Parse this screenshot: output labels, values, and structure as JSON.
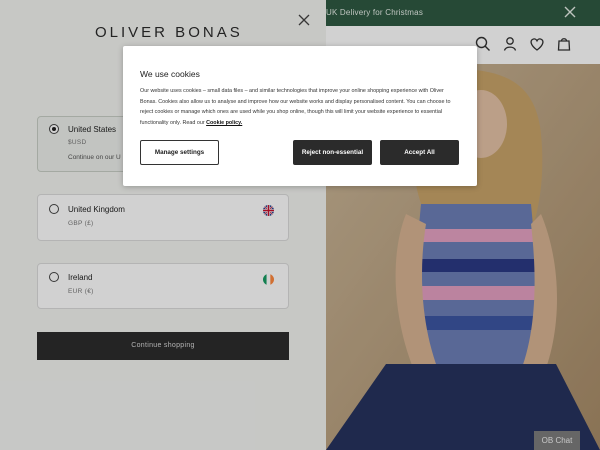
{
  "promo_bar": {
    "text": "UK Delivery for Christmas"
  },
  "drawer": {
    "logo": "OLIVER BONAS",
    "countries": [
      {
        "name": "United States",
        "currency": "$USD",
        "note": "Continue on our U",
        "selected": true
      },
      {
        "name": "United Kingdom",
        "currency": "GBP (£)",
        "selected": false
      },
      {
        "name": "Ireland",
        "currency": "EUR (€)",
        "selected": false
      }
    ],
    "continue_label": "Continue shopping"
  },
  "cookie_modal": {
    "title": "We use cookies",
    "body": "Our website uses cookies – small data files – and similar technologies that improve your online shopping experience with Oliver Bonas. Cookies also allow us to analyse and improve how our website works and display personalised content. You can choose to reject cookies or manage which ones are used while you shop online, though this will limit your website experience to essential functionality only. Read our",
    "link_text": "Cookie policy.",
    "manage_label": "Manage settings",
    "reject_label": "Reject non-essential",
    "accept_label": "Accept All"
  },
  "chat": {
    "label": "OB Chat"
  },
  "icons": [
    "close-icon",
    "search-icon",
    "account-icon",
    "heart-icon",
    "bag-icon",
    "uk-flag-icon",
    "ireland-flag-icon"
  ],
  "colors": {
    "promo_green": "#2f5a43",
    "button_dark": "#2b2b2b",
    "drawer_bg": "#f3f4f1"
  }
}
